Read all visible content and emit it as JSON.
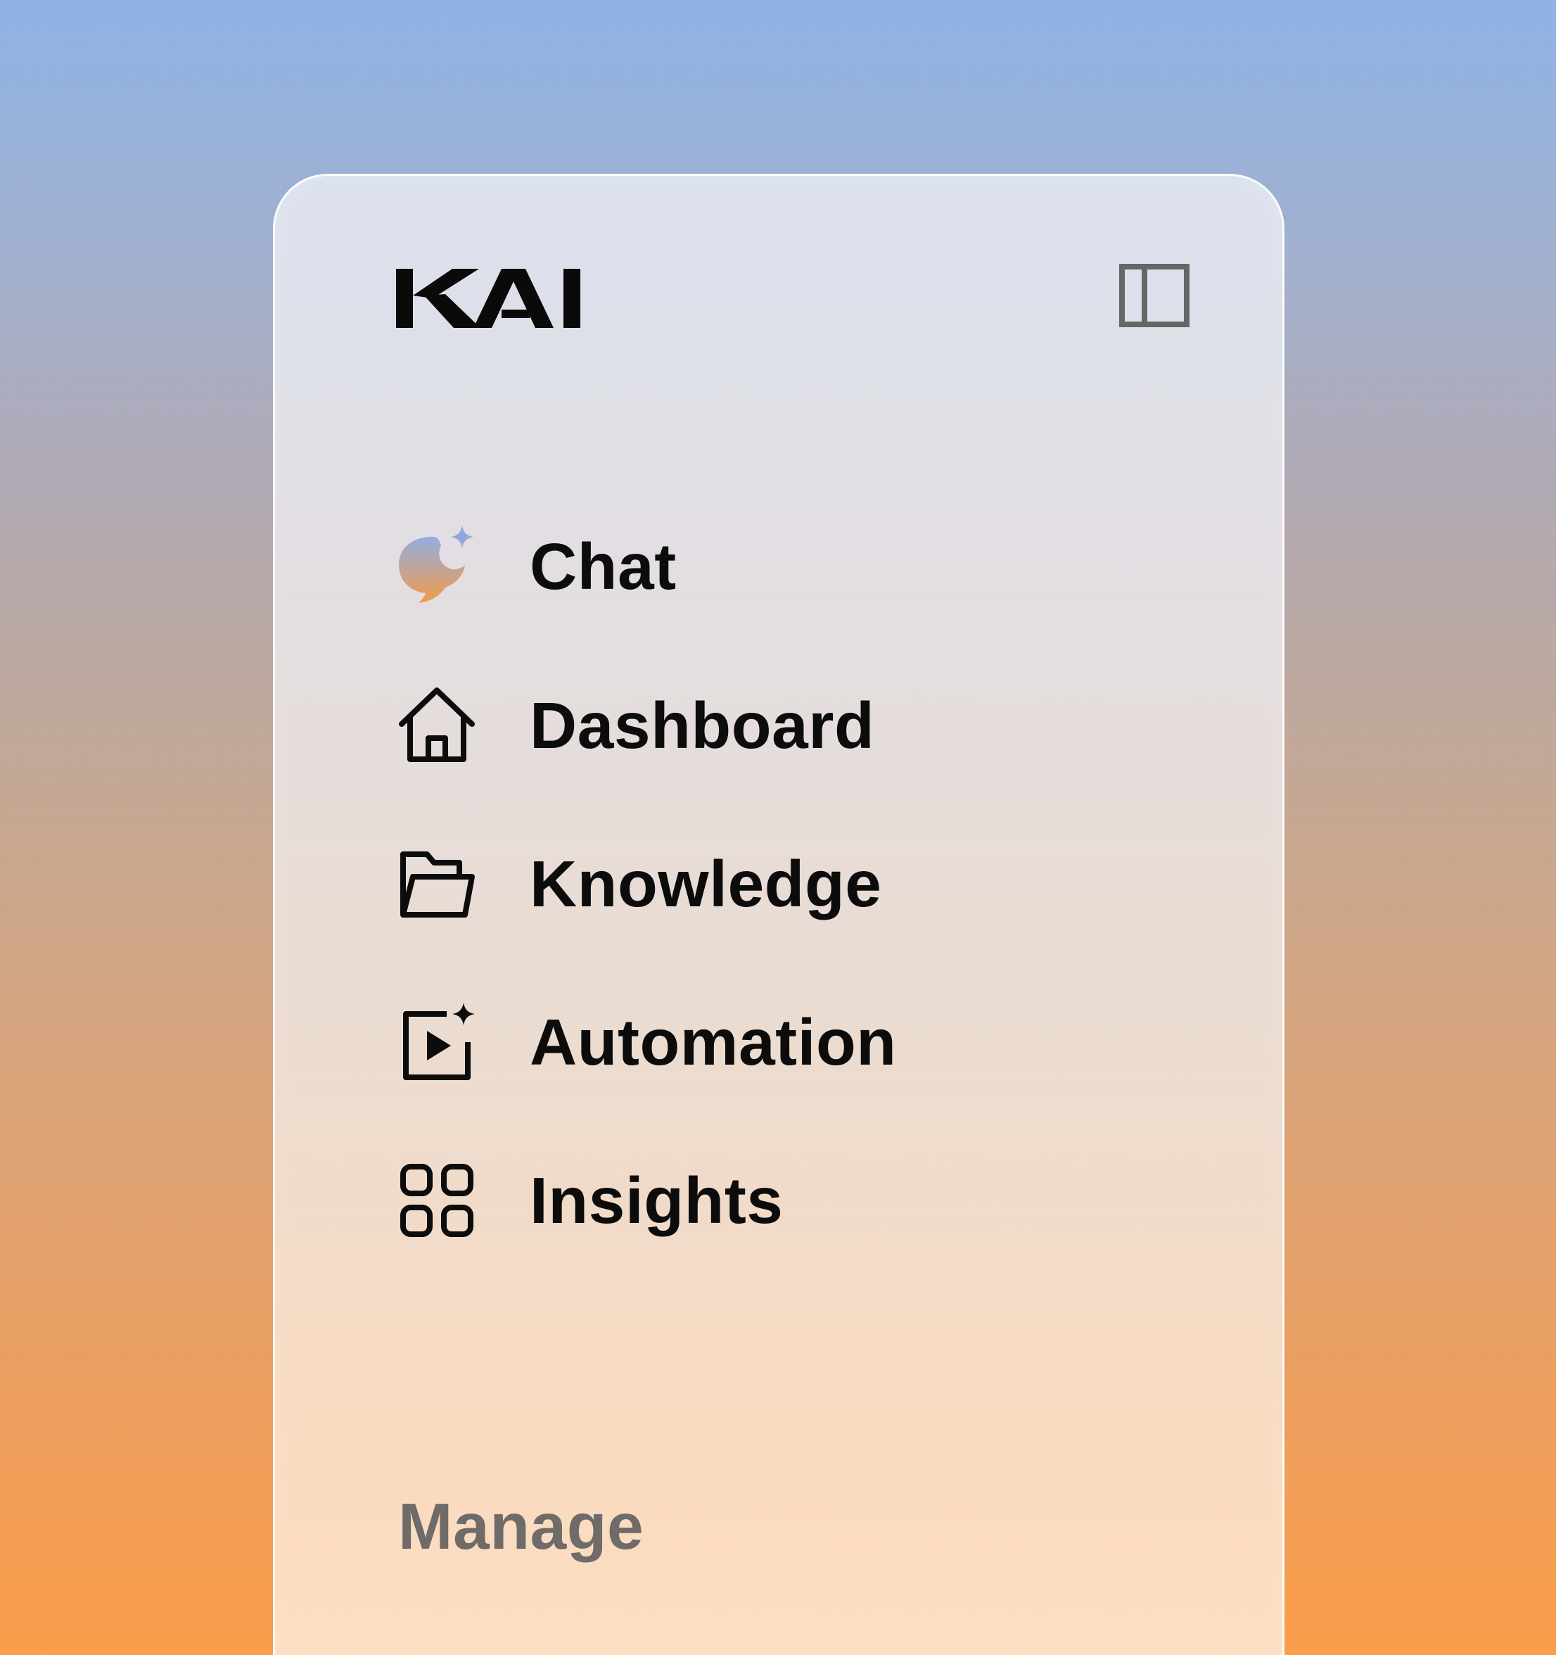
{
  "brand": {
    "logo_text": "KAI"
  },
  "header": {
    "toggle_icon": "sidebar-panel-icon"
  },
  "nav": {
    "items": [
      {
        "label": "Chat",
        "icon": "chat-sparkle-icon"
      },
      {
        "label": "Dashboard",
        "icon": "home-icon"
      },
      {
        "label": "Knowledge",
        "icon": "folder-open-icon"
      },
      {
        "label": "Automation",
        "icon": "play-sparkle-icon"
      },
      {
        "label": "Insights",
        "icon": "grid-icon"
      }
    ]
  },
  "sections": {
    "manage_heading": "Manage"
  },
  "colors": {
    "text_primary": "#0c0c0c",
    "text_muted": "#6f6b68",
    "chat_icon_gradient_top": "#93aee0",
    "chat_icon_gradient_bottom": "#f39a4a",
    "background_top": "#8fb3e6",
    "background_bottom": "#fb9d4b"
  }
}
